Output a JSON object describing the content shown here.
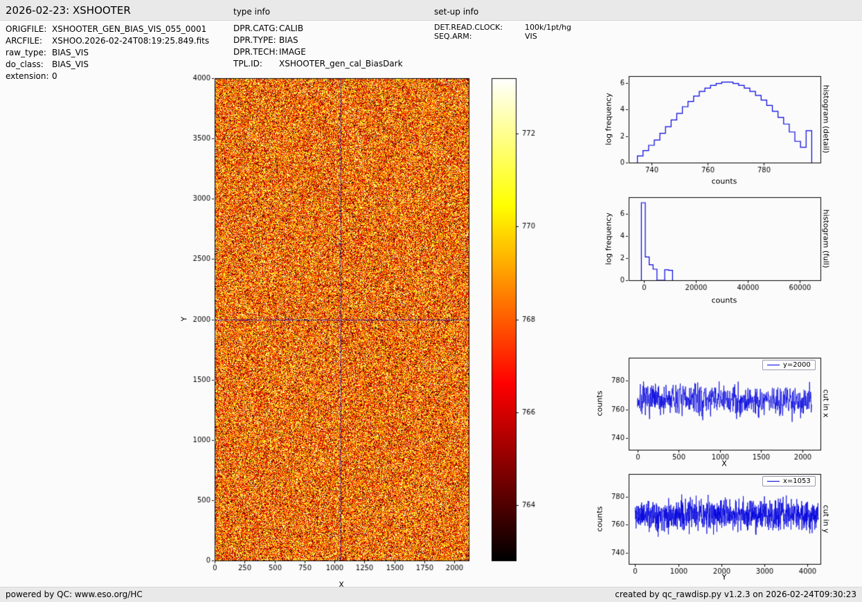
{
  "header": {
    "title": "2026-02-23: XSHOOTER",
    "type_info_label": "type info",
    "setup_info_label": "set-up info"
  },
  "file_info": {
    "rows": [
      {
        "label": "ORIGFILE:",
        "value": "XSHOOTER_GEN_BIAS_VIS_055_0001"
      },
      {
        "label": "ARCFILE:",
        "value": "XSHOO.2026-02-24T08:19:25.849.fits"
      },
      {
        "label": "raw_type:",
        "value": "BIAS_VIS"
      },
      {
        "label": "do_class:",
        "value": "BIAS_VIS"
      },
      {
        "label": "extension:",
        "value": "0"
      }
    ]
  },
  "type_info": {
    "rows": [
      {
        "label": "DPR.CATG:",
        "value": "CALIB"
      },
      {
        "label": "DPR.TYPE:",
        "value": "BIAS"
      },
      {
        "label": "DPR.TECH:",
        "value": "IMAGE"
      },
      {
        "label": "TPL.ID:",
        "value": "XSHOOTER_gen_cal_BiasDark"
      }
    ]
  },
  "setup_info": {
    "rows": [
      {
        "label": "DET.READ.CLOCK:",
        "value": "100k/1pt/hg"
      },
      {
        "label": "SEQ.ARM:",
        "value": "VIS"
      }
    ]
  },
  "footer": {
    "left": "powered by QC: www.eso.org/HC",
    "right": "created by qc_rawdisp.py v1.2.3 on 2026-02-24T09:30:23"
  },
  "chart_data": [
    {
      "id": "bias_image",
      "type": "heatmap",
      "xlabel": "X",
      "ylabel": "Y",
      "xlim": [
        0,
        2120
      ],
      "ylim": [
        0,
        4000
      ],
      "xticks": [
        0,
        250,
        500,
        750,
        1000,
        1250,
        1500,
        1750,
        2000
      ],
      "yticks": [
        0,
        500,
        1000,
        1500,
        2000,
        2500,
        3000,
        3500,
        4000
      ],
      "colormap": "hot",
      "vmin": 762.8,
      "vmax": 773.2,
      "colorbar_ticks": [
        764,
        766,
        768,
        770,
        772
      ],
      "mean_counts": 766.5,
      "noise_sigma": 3,
      "crosshair": {
        "x": 1053,
        "y": 2000,
        "color": "#2525b5"
      }
    },
    {
      "id": "histogram_detail",
      "type": "bar",
      "side_label": "histogram (detail)",
      "xlabel": "counts",
      "ylabel": "log frequency",
      "xlim": [
        731.9,
        800.1
      ],
      "ylim": [
        0,
        6.5
      ],
      "xticks": [
        740,
        760,
        780
      ],
      "yticks": [
        0,
        2,
        4,
        6
      ],
      "bin_start": 735,
      "bin_width": 2,
      "values": [
        0.5,
        0.9,
        1.3,
        1.7,
        2.2,
        2.7,
        3.2,
        3.7,
        4.2,
        4.6,
        5.0,
        5.35,
        5.6,
        5.8,
        5.95,
        6.05,
        6.05,
        5.95,
        5.8,
        5.6,
        5.35,
        5.05,
        4.7,
        4.3,
        3.85,
        3.4,
        2.9,
        2.3,
        1.6,
        1.15,
        2.4
      ],
      "line_color": "#0000dd"
    },
    {
      "id": "histogram_full",
      "type": "bar",
      "side_label": "histogram (full)",
      "xlabel": "counts",
      "ylabel": "log frequency",
      "xlim": [
        -5900,
        68000
      ],
      "ylim": [
        0,
        7.5
      ],
      "xticks": [
        0,
        20000,
        40000,
        60000
      ],
      "yticks": [
        0,
        2,
        4,
        6
      ],
      "bin_start": -1000,
      "bin_width": 1500,
      "values": [
        7.0,
        2.1,
        1.4,
        1.0,
        0,
        0,
        0.95,
        0.9
      ],
      "line_color": "#0000dd"
    },
    {
      "id": "cut_in_x",
      "type": "line",
      "side_label": "cut in x",
      "legend": "y=2000",
      "xlabel": "X",
      "ylabel": "counts",
      "xlim": [
        -106,
        2218
      ],
      "ylim": [
        732,
        796
      ],
      "xticks": [
        0,
        500,
        1000,
        1500,
        2000
      ],
      "yticks": [
        740,
        760,
        780
      ],
      "data_xmin": 0,
      "data_xmax": 2112,
      "n_points": 660,
      "mean": 766.5,
      "sigma": 5.5,
      "line_color": "#0000dd"
    },
    {
      "id": "cut_in_y",
      "type": "line",
      "side_label": "cut in y",
      "legend": "x=1053",
      "xlabel": "Y",
      "ylabel": "counts",
      "xlim": [
        -150,
        4300
      ],
      "ylim": [
        732,
        796
      ],
      "xticks": [
        0,
        1000,
        2000,
        3000,
        4000
      ],
      "yticks": [
        740,
        760,
        780
      ],
      "data_xmin": 0,
      "data_xmax": 4250,
      "n_points": 980,
      "mean": 767,
      "sigma": 5.5,
      "line_color": "#0000dd"
    }
  ]
}
